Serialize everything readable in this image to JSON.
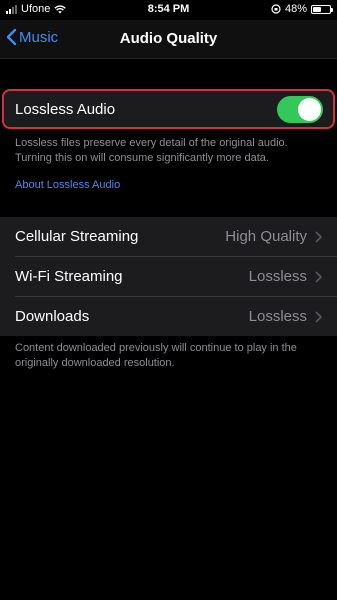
{
  "status": {
    "carrier": "Ufone",
    "time": "8:54 PM",
    "battery": "48%"
  },
  "nav": {
    "back_label": "Music",
    "title": "Audio Quality"
  },
  "lossless": {
    "label": "Lossless Audio",
    "enabled": true,
    "description": "Lossless files preserve every detail of the original audio. Turning this on will consume significantly more data.",
    "link": "About Lossless Audio"
  },
  "settings": [
    {
      "label": "Cellular Streaming",
      "value": "High Quality"
    },
    {
      "label": "Wi-Fi Streaming",
      "value": "Lossless"
    },
    {
      "label": "Downloads",
      "value": "Lossless"
    }
  ],
  "footer_note": "Content downloaded previously will continue to play in the originally downloaded resolution.",
  "colors": {
    "accent": "#3b8ef5",
    "toggle_on": "#34c759",
    "highlight": "#d0333b"
  }
}
